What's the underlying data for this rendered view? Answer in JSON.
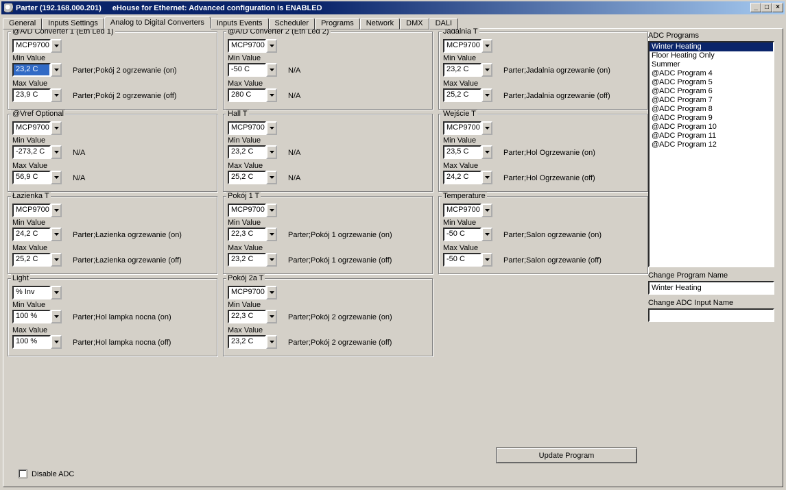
{
  "window": {
    "title_left": "Parter (192.168.000.201)",
    "title_right": "eHouse for Ethernet: Advanced configuration is ENABLED"
  },
  "tabs": [
    "General",
    "Inputs Settings",
    "Analog to Digital Converters",
    "Inputs Events",
    "Scheduler",
    "Programs",
    "Network",
    "DMX",
    "DALI"
  ],
  "active_tab": "Analog to Digital Converters",
  "labels": {
    "min": "Min Value",
    "max": "Max Value",
    "adc_programs": "ADC Programs",
    "change_program_name": "Change Program Name",
    "change_adc_input_name": "Change ADC Input Name",
    "update_program": "Update Program",
    "disable_adc": "Disable ADC"
  },
  "cols": [
    [
      {
        "name": "@A/D Converter 1 (Eth Led 1)",
        "sensor": "MCP9700",
        "min": "23,2 C",
        "min_sel": true,
        "min_evt": "Parter;Pokój 2 ogrzewanie (on)",
        "max": "23,9 C",
        "max_evt": "Parter;Pokój 2 ogrzewanie (off)"
      },
      {
        "name": "@Vref Optional",
        "sensor": "MCP9700",
        "min": "-273,2 C",
        "min_evt": "N/A",
        "max": "56,9 C",
        "max_evt": "N/A"
      },
      {
        "name": "Łazienka T",
        "sensor": "MCP9700",
        "min": "24,2 C",
        "min_evt": "Parter;Łazienka ogrzewanie (on)",
        "max": "25,2 C",
        "max_evt": "Parter;Łazienka ogrzewanie (off)"
      },
      {
        "name": "Light",
        "sensor": "% Inv",
        "min": "100 %",
        "min_evt": "Parter;Hol lampka nocna (on)",
        "max": "100 %",
        "max_evt": "Parter;Hol lampka nocna (off)"
      }
    ],
    [
      {
        "name": "@A/D Converter 2 (Eth Led 2)",
        "sensor": "MCP9700",
        "min": "-50 C",
        "min_evt": "N/A",
        "max": "280 C",
        "max_evt": "N/A"
      },
      {
        "name": "Hall T",
        "sensor": "MCP9700",
        "min": "23,2 C",
        "min_evt": "N/A",
        "max": "25,2 C",
        "max_evt": "N/A"
      },
      {
        "name": "Pokój 1 T",
        "sensor": "MCP9700",
        "min": "22,3 C",
        "min_evt": "Parter;Pokój 1 ogrzewanie (on)",
        "max": "23,2 C",
        "max_evt": "Parter;Pokój 1 ogrzewanie (off)"
      },
      {
        "name": "Pokój 2a T",
        "sensor": "MCP9700",
        "min": "22,3 C",
        "min_evt": "Parter;Pokój 2 ogrzewanie (on)",
        "max": "23,2 C",
        "max_evt": "Parter;Pokój 2 ogrzewanie (off)"
      }
    ],
    [
      {
        "name": "Jadalnia T",
        "sensor": "MCP9700",
        "min": "23,2 C",
        "min_evt": "Parter;Jadalnia ogrzewanie (on)",
        "max": "25,2 C",
        "max_evt": "Parter;Jadalnia ogrzewanie (off)"
      },
      {
        "name": "Wejście T",
        "sensor": "MCP9700",
        "min": "23,5 C",
        "min_evt": "Parter;Hol Ogrzewanie (on)",
        "max": "24,2 C",
        "max_evt": "Parter;Hol Ogrzewanie (off)"
      },
      {
        "name": "Temperature",
        "sensor": "MCP9700",
        "min": "-50 C",
        "min_evt": "Parter;Salon ogrzewanie (on)",
        "max": "-50 C",
        "max_evt": "Parter;Salon ogrzewanie (off)"
      }
    ]
  ],
  "programs": [
    "Winter Heating",
    "Floor Heating Only",
    "Summer",
    "@ADC Program 4",
    "@ADC Program 5",
    "@ADC Program 6",
    "@ADC Program 7",
    "@ADC Program 8",
    "@ADC Program 9",
    "@ADC Program 10",
    "@ADC Program 11",
    "@ADC Program 12"
  ],
  "selected_program": "Winter Heating",
  "program_name_value": "Winter Heating",
  "adc_input_name_value": ""
}
